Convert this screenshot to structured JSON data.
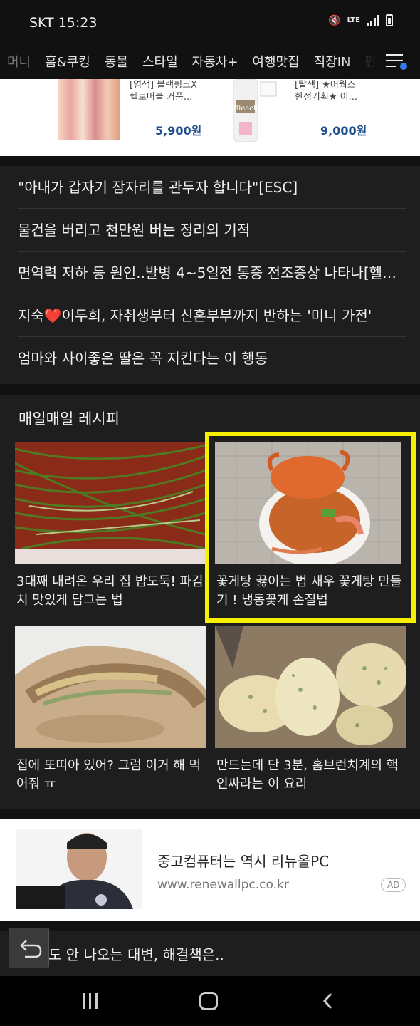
{
  "status_bar": {
    "carrier_time": "SKT 15:23",
    "network": "LTE"
  },
  "nav": {
    "tabs": [
      "머니",
      "홈&쿠킹",
      "동물",
      "스타일",
      "자동차+",
      "여행맛집",
      "직장IN",
      "펀"
    ],
    "menu_icon": "menu-notification-icon"
  },
  "products": [
    {
      "name_line1": "[염색] 블랙핑크X",
      "name_line2": "헬로버블 거품...",
      "price": "5,900원"
    },
    {
      "name_line1": "[탈색] ★어웍스",
      "name_line2": "한정기획★ 이...",
      "price": "9,000원"
    }
  ],
  "headlines": [
    "\"아내가 갑자기 잠자리를 관두자 합니다\"[ESC]",
    "물건을 버리고 천만원 버는 정리의 기적",
    "면역력 저하 등 원인..발병 4~5일전 통증 전조증상 나타나[헬스...",
    "지숙❤️이두희, 자취생부터 신혼부부까지 반하는 '미니 가전'",
    "엄마와 사이좋은 딸은 꼭 지킨다는 이 행동"
  ],
  "recipes": {
    "title": "매일매일 레시피",
    "cards": [
      {
        "caption": "3대째 내려온 우리 집 밥도둑! 파김치 맛있게 담그는 법",
        "image": "green-onion-kimchi"
      },
      {
        "caption": "꽃게탕 끓이는 법 새우 꽃게탕 만들기 ! 냉동꽃게 손질법",
        "image": "crab-stew"
      },
      {
        "caption": "집에 또띠아 있어? 그럼 이거 해 먹어줘 ㅠ",
        "image": "tortilla-wrap"
      },
      {
        "caption": "만드는데 단 3분, 홈브런치계의 핵인싸라는 이 요리",
        "image": "herb-butter"
      }
    ],
    "highlight_color": "#f7f000"
  },
  "ad": {
    "text": "중고컴퓨터는 역시 리뉴올PC",
    "url": "www.renewallpc.co.kr",
    "badge": "AD"
  },
  "bottom_article": {
    "title": "도 안 나오는 대변, 해결책은.."
  }
}
